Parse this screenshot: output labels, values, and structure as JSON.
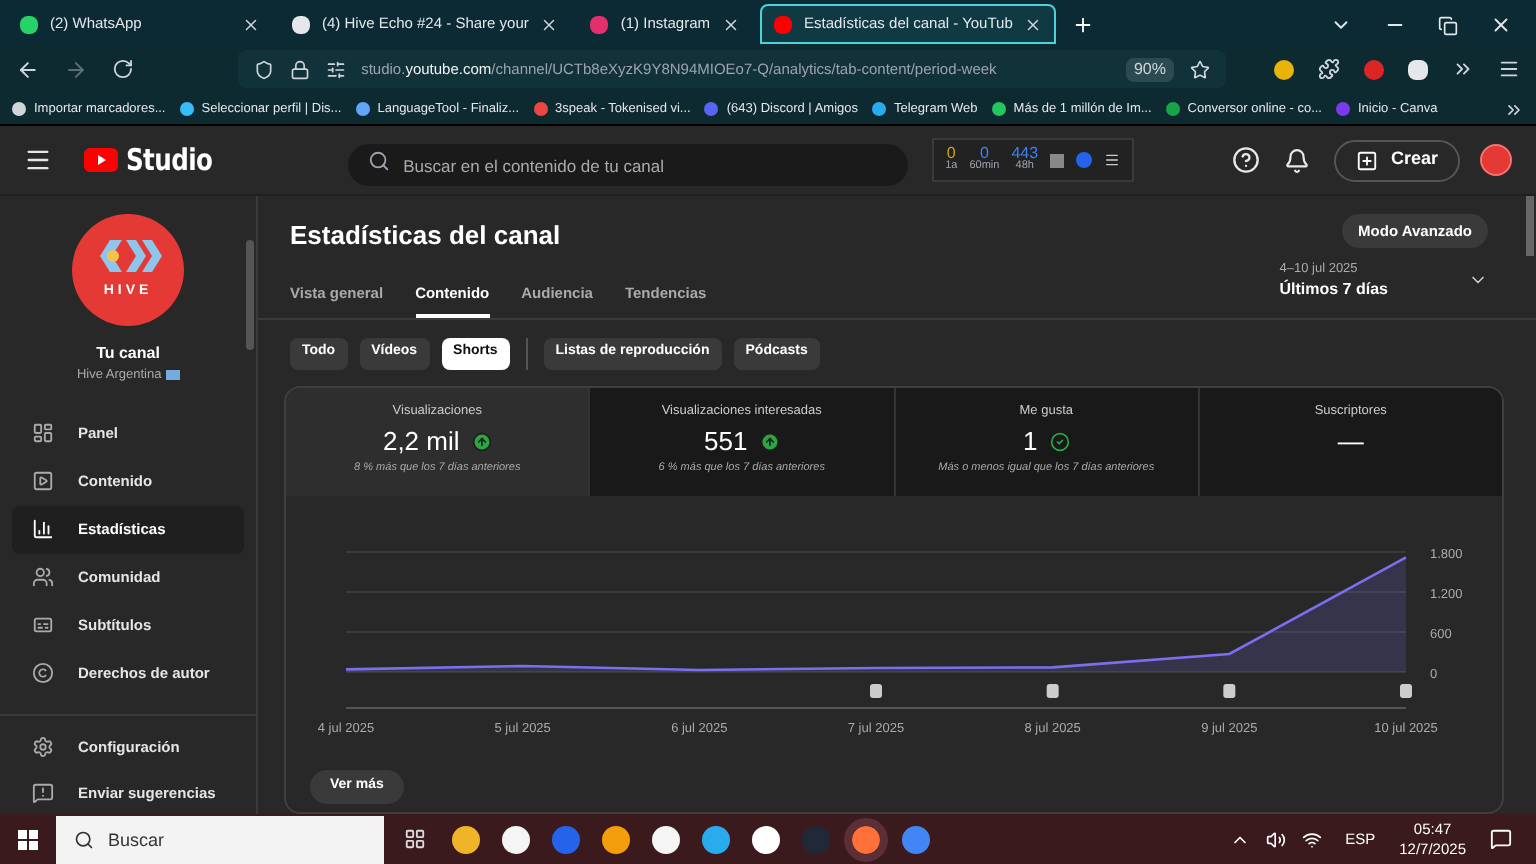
{
  "browser_tabs": [
    {
      "title": "(2) WhatsApp",
      "selected": false,
      "color": "#25d366"
    },
    {
      "title": "(4) Hive Echo #24 - Share your",
      "selected": false,
      "color": "#e5e7eb"
    },
    {
      "title": "(1) Instagram",
      "selected": false,
      "color": "#e1306c"
    },
    {
      "title": "Estadísticas del canal - YouTub",
      "selected": true,
      "color": "#ff0000"
    }
  ],
  "address_bar": {
    "prefix": "studio.",
    "domain": "youtube.com",
    "path": "/channel/UCTb8eXyzK9Y8N94MIOEo7-Q/analytics/tab-content/period-week",
    "zoom": "90%"
  },
  "bookmarks": [
    {
      "title": "Importar marcadores...",
      "color": "#d1d5db"
    },
    {
      "title": "Seleccionar perfil | Dis...",
      "color": "#38bdf8"
    },
    {
      "title": "LanguageTool - Finaliz...",
      "color": "#60a5fa"
    },
    {
      "title": "3speak - Tokenised vi...",
      "color": "#ef4444"
    },
    {
      "title": "(643) Discord | Amigos",
      "color": "#5865f2"
    },
    {
      "title": "Telegram Web",
      "color": "#2aabee"
    },
    {
      "title": "Más de 1 millón de Im...",
      "color": "#22c55e"
    },
    {
      "title": "Conversor online - co...",
      "color": "#16a34a"
    },
    {
      "title": "Inicio - Canva",
      "color": "#7c3aed"
    }
  ],
  "header": {
    "logo": "Studio",
    "search_placeholder": "Buscar en el contenido de tu canal",
    "extension_counters": [
      {
        "value": "0",
        "caption": "1a",
        "color": "#d4a017"
      },
      {
        "value": "0",
        "caption": "60min",
        "color": "#3b82f6"
      },
      {
        "value": "443",
        "caption": "48h",
        "color": "#3b82f6"
      }
    ],
    "create_button": "Crear"
  },
  "sidebar": {
    "channel_logo": "HIVE",
    "channel_title": "Tu canal",
    "channel_name": "Hive Argentina",
    "items": [
      {
        "label": "Panel",
        "kind": "panel",
        "selected": false
      },
      {
        "label": "Contenido",
        "kind": "content",
        "selected": false
      },
      {
        "label": "Estadísticas",
        "kind": "stats",
        "selected": true
      },
      {
        "label": "Comunidad",
        "kind": "community",
        "selected": false
      },
      {
        "label": "Subtítulos",
        "kind": "subtitles",
        "selected": false
      },
      {
        "label": "Derechos de autor",
        "kind": "copyright",
        "selected": false
      }
    ],
    "bottom_items": [
      {
        "label": "Configuración",
        "kind": "settings"
      },
      {
        "label": "Enviar sugerencias",
        "kind": "feedback"
      }
    ]
  },
  "page": {
    "title": "Estadísticas del canal",
    "advanced_button": "Modo Avanzado",
    "tabs": [
      {
        "label": "Vista general",
        "selected": false
      },
      {
        "label": "Contenido",
        "selected": true
      },
      {
        "label": "Audiencia",
        "selected": false
      },
      {
        "label": "Tendencias",
        "selected": false
      }
    ],
    "date_range": "4–10 jul 2025",
    "period": "Últimos 7 días",
    "filters": [
      {
        "label": "Todo",
        "selected": false
      },
      {
        "label": "Vídeos",
        "selected": false
      },
      {
        "label": "Shorts",
        "selected": true
      },
      {
        "label": "Listas de reproducción",
        "selected": false
      },
      {
        "label": "Pódcasts",
        "selected": false
      }
    ],
    "metrics": [
      {
        "label": "Visualizaciones",
        "value": "2,2 mil",
        "kind": "up",
        "note": "8 % más que los 7 días anteriores",
        "selected": true
      },
      {
        "label": "Visualizaciones interesadas",
        "value": "551",
        "kind": "up",
        "note": "6 % más que los 7 días anteriores",
        "selected": false
      },
      {
        "label": "Me gusta",
        "value": "1",
        "kind": "same",
        "note": "Más o menos igual que los 7 días anteriores",
        "selected": false
      },
      {
        "label": "Suscriptores",
        "value": "—",
        "kind": "none",
        "selected": false
      }
    ],
    "chart_data": {
      "type": "area",
      "categories": [
        "4 jul 2025",
        "5 jul 2025",
        "6 jul 2025",
        "7 jul 2025",
        "8 jul 2025",
        "9 jul 2025",
        "10 jul 2025"
      ],
      "series": [
        {
          "color": "#7b6ff0",
          "values": [
            40,
            90,
            30,
            60,
            70,
            270,
            1720
          ]
        }
      ],
      "ylim": [
        0,
        1800
      ],
      "yticks": [
        {
          "value": 0,
          "label": "0"
        },
        {
          "value": 600,
          "label": "600"
        },
        {
          "value": 1200,
          "label": "1.200"
        },
        {
          "value": 1800,
          "label": "1.800"
        }
      ]
    },
    "chart_markers": [
      {
        "shown": false
      },
      {
        "shown": false
      },
      {
        "shown": false
      },
      {
        "shown": true
      },
      {
        "shown": true
      },
      {
        "shown": true
      },
      {
        "shown": true
      }
    ],
    "more_button": "Ver más"
  },
  "taskbar": {
    "search_placeholder": "Buscar",
    "language": "ESP",
    "time": "05:47",
    "date": "12/7/2025"
  }
}
